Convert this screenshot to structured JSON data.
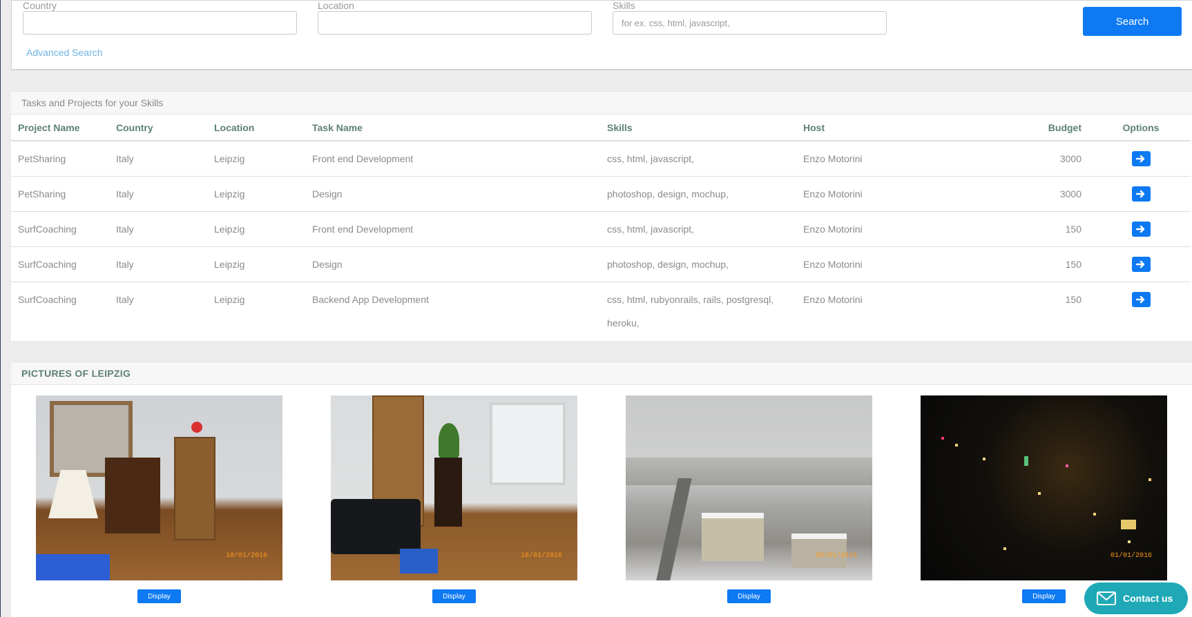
{
  "search": {
    "country_label": "Country",
    "country_value": "",
    "location_label": "Location",
    "location_value": "",
    "skills_label": "Skills",
    "skills_placeholder": "for ex. css, html, javascript,",
    "search_button": "Search",
    "advanced_link": "Advanced Search"
  },
  "tasks": {
    "heading": "Tasks and Projects for your Skills",
    "columns": [
      "Project Name",
      "Country",
      "Location",
      "Task Name",
      "Skills",
      "Host",
      "Budget",
      "Options"
    ],
    "rows": [
      {
        "project": "PetSharing",
        "country": "Italy",
        "location": "Leipzig",
        "task": "Front end Development",
        "skills": "css, html, javascript,",
        "host": "Enzo Motorini",
        "budget": "3000"
      },
      {
        "project": "PetSharing",
        "country": "Italy",
        "location": "Leipzig",
        "task": "Design",
        "skills": "photoshop, design, mochup,",
        "host": "Enzo Motorini",
        "budget": "3000"
      },
      {
        "project": "SurfCoaching",
        "country": "Italy",
        "location": "Leipzig",
        "task": "Front end Development",
        "skills": "css, html, javascript,",
        "host": "Enzo Motorini",
        "budget": "150"
      },
      {
        "project": "SurfCoaching",
        "country": "Italy",
        "location": "Leipzig",
        "task": "Design",
        "skills": "photoshop, design, mochup,",
        "host": "Enzo Motorini",
        "budget": "150"
      },
      {
        "project": "SurfCoaching",
        "country": "Italy",
        "location": "Leipzig",
        "task": "Backend App Development",
        "skills": "css, html, rubyonrails, rails, postgresql, heroku,",
        "host": "Enzo Motorini",
        "budget": "150"
      }
    ]
  },
  "pictures": {
    "heading": "PICTURES OF LEIPZIG",
    "items": [
      {
        "stamp": "18/01/2016",
        "button": "Display"
      },
      {
        "stamp": "18/01/2016",
        "button": "Display"
      },
      {
        "stamp": "05/01/2016",
        "button": "Display"
      },
      {
        "stamp": "01/01/2016",
        "button": "Display"
      }
    ]
  },
  "contact": {
    "label": "Contact us"
  },
  "colors": {
    "accent": "#0d79f2",
    "contact": "#1fa9b6",
    "heading": "#5d7f78"
  }
}
